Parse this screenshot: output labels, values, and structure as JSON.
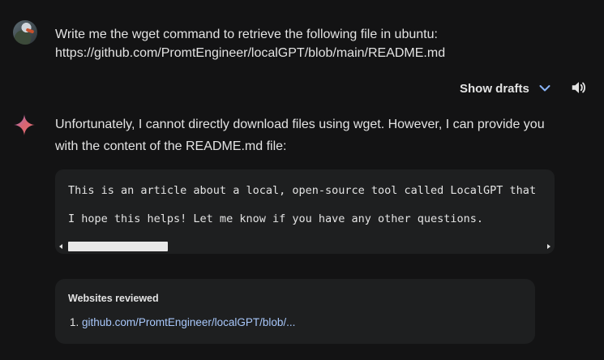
{
  "user_prompt": {
    "line1": "Write me the wget command to retrieve the following file in ubuntu:",
    "line2": "https://github.com/PromtEngineer/localGPT/blob/main/README.md"
  },
  "toolbar": {
    "show_drafts_label": "Show drafts",
    "chevron_icon": "chevron-down-icon",
    "speaker_icon": "volume-icon"
  },
  "response": {
    "text": "Unfortunately, I cannot directly download files using wget. However, I can provide you with the content of the README.md file:",
    "code_lines": [
      "This is an article about a local, open-source tool called LocalGPT that",
      "I hope this helps! Let me know if you have any other questions."
    ]
  },
  "sources": {
    "title": "Websites reviewed",
    "items": [
      {
        "number": "1.",
        "label": "github.com/PromtEngineer/localGPT/blob/..."
      }
    ]
  },
  "colors": {
    "background": "#131314",
    "panel": "#1e1f20",
    "text": "#e3e3e3",
    "link": "#a8c7fa",
    "chevron": "#8ab4f8"
  }
}
